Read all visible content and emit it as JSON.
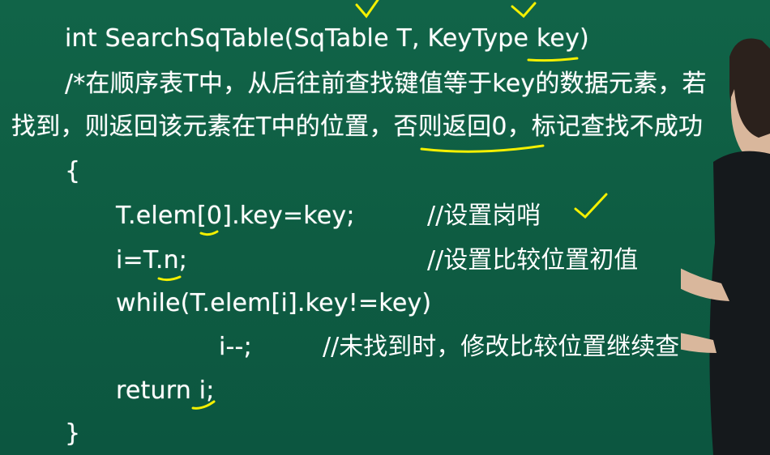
{
  "code": {
    "signature": "int SearchSqTable(SqTable T, KeyType key)",
    "comment_line1": "/*在顺序表T中，从后往前查找键值等于key的数据元素，若",
    "comment_line2": "找到，则返回该元素在T中的位置，否则返回0，标记查找不成功",
    "open_brace": "{",
    "stmt1": "T.elem[0].key=key;",
    "stmt1_comment": "//设置岗哨",
    "stmt2": "i=T.n;",
    "stmt2_comment": "//设置比较位置初值",
    "stmt3": "while(T.elem[i].key!=key)",
    "stmt4": "i--;",
    "stmt4_comment": "//未找到时，修改比较位置继续查",
    "stmt5": "return i;",
    "close_brace": "}"
  },
  "colors": {
    "board": "#0f5f46",
    "text": "#ffffff",
    "annotation": "#f4f000"
  }
}
